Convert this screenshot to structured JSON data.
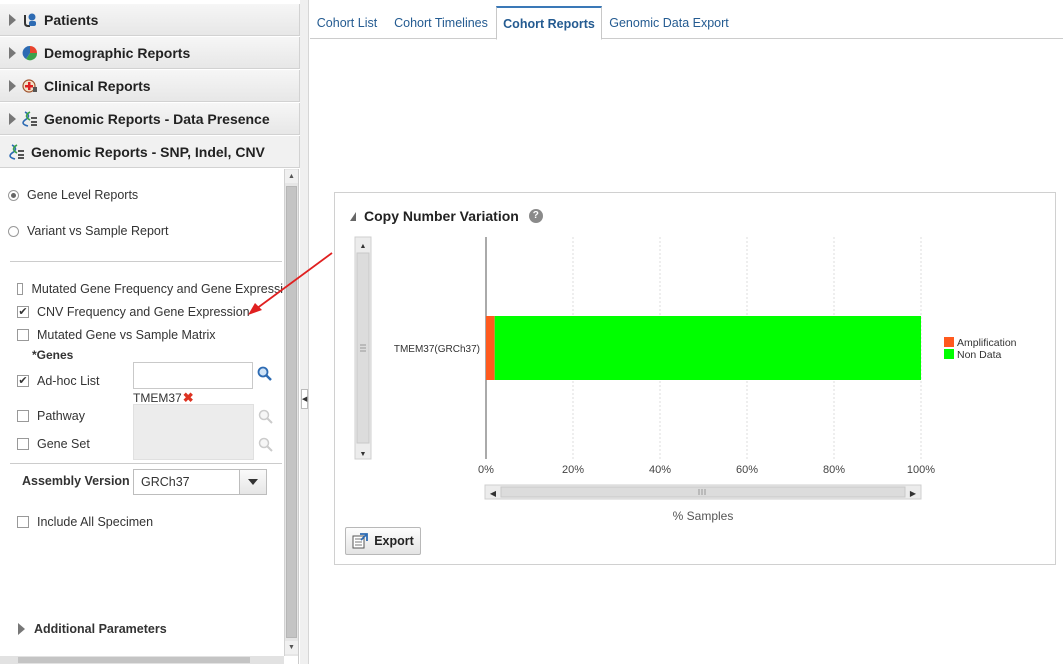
{
  "sidebar": {
    "sections": [
      {
        "label": "Patients",
        "icon": "patients-icon"
      },
      {
        "label": "Demographic Reports",
        "icon": "pie-chart-icon"
      },
      {
        "label": "Clinical Reports",
        "icon": "clinical-icon"
      },
      {
        "label": "Genomic Reports - Data Presence",
        "icon": "dna-icon"
      },
      {
        "label": "Genomic Reports - SNP, Indel, CNV",
        "icon": "dna-icon"
      }
    ],
    "report_types": [
      "Gene Level Reports",
      "Variant vs Sample Report"
    ],
    "report_options": [
      {
        "label": "Mutated Gene Frequency and Gene Expressi",
        "checked": false
      },
      {
        "label": "CNV Frequency and Gene Expression",
        "checked": true
      },
      {
        "label": "Mutated Gene vs Sample Matrix",
        "checked": false
      }
    ],
    "genes_label": "*Genes",
    "adhoc_label": "Ad-hoc List",
    "adhoc_tag": "TMEM37",
    "pathway_label": "Pathway",
    "geneset_label": "Gene Set",
    "assembly_label": "Assembly Version",
    "assembly_value": "GRCh37",
    "include_all_label": "Include All Specimen",
    "additional_label": "Additional Parameters"
  },
  "tabs": [
    "Cohort List",
    "Cohort Timelines",
    "Cohort Reports",
    "Genomic Data Export"
  ],
  "active_tab": "Cohort Reports",
  "panel": {
    "title": "Copy Number Variation",
    "help": "?",
    "export_label": "Export"
  },
  "colors": {
    "amplification": "#ff5a1e",
    "non_data": "#00ff00",
    "annotation_arrow": "#e02020"
  },
  "chart_data": {
    "type": "bar",
    "orientation": "horizontal",
    "stacked": true,
    "categories": [
      "TMEM37(GRCh37)"
    ],
    "series": [
      {
        "name": "Amplification",
        "values": [
          2
        ]
      },
      {
        "name": "Non Data",
        "values": [
          98
        ]
      }
    ],
    "xlabel": "% Samples",
    "xlim": [
      0,
      100
    ],
    "xticks": [
      "0%",
      "20%",
      "40%",
      "60%",
      "80%",
      "100%"
    ],
    "grid": true,
    "legend": "right"
  }
}
